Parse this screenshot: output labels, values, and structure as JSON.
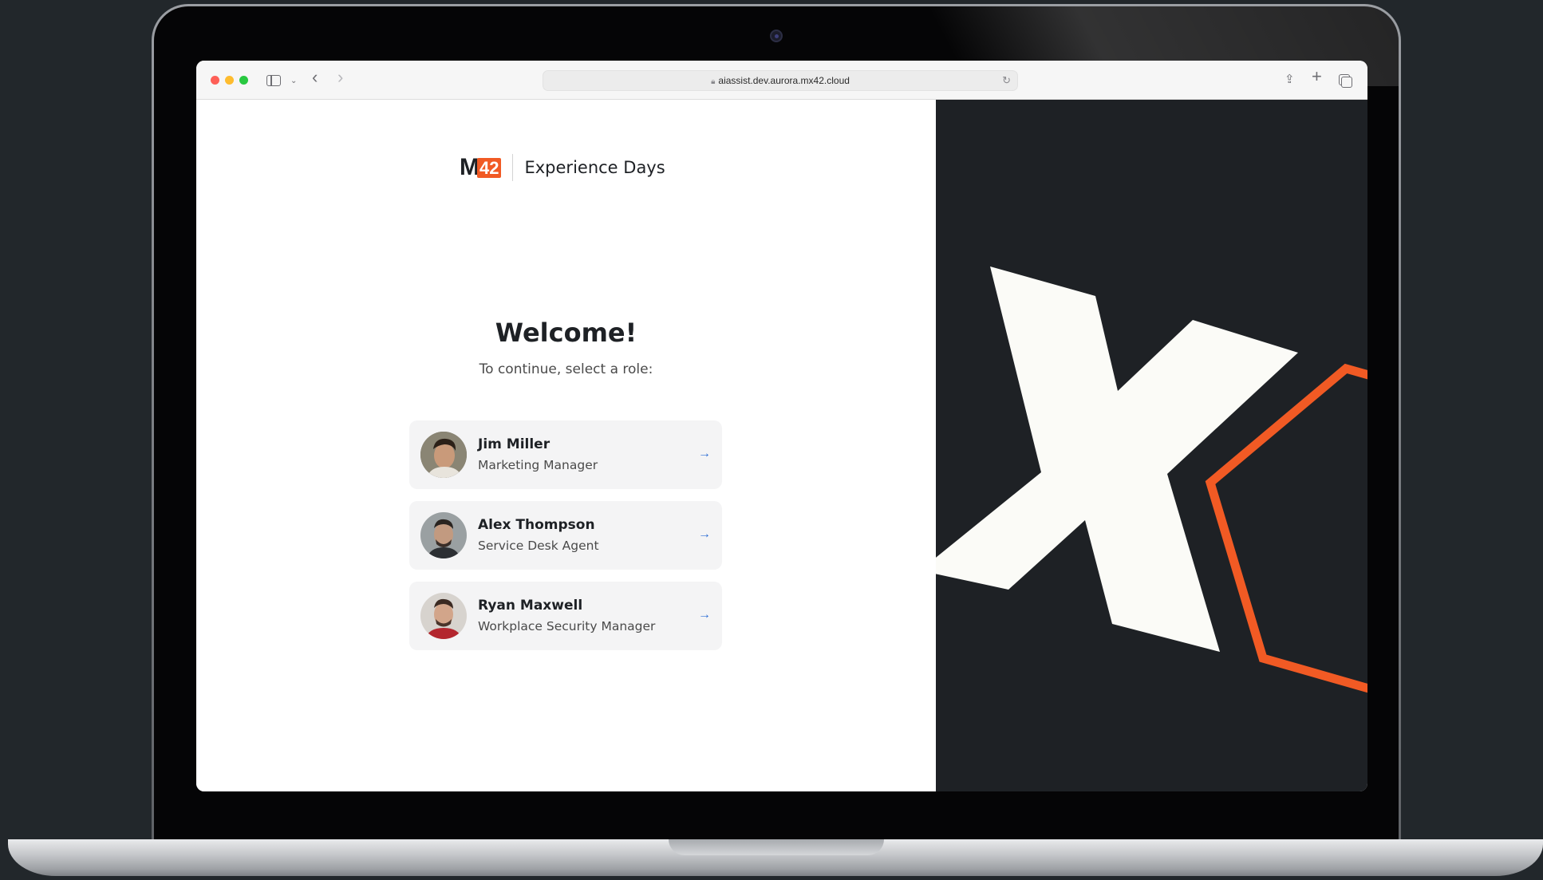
{
  "browser": {
    "url": "aiassist.dev.aurora.mx42.cloud"
  },
  "brand": {
    "logo_m": "M",
    "logo_42": "42",
    "title": "Experience Days"
  },
  "welcome": {
    "heading": "Welcome!",
    "subtitle": "To continue, select a role:"
  },
  "roles": [
    {
      "name": "Jim Miller",
      "title": "Marketing Manager"
    },
    {
      "name": "Alex Thompson",
      "title": "Service Desk Agent"
    },
    {
      "name": "Ryan Maxwell",
      "title": "Workplace Security Manager"
    }
  ],
  "colors": {
    "accent_orange": "#f15a24",
    "dark_panel": "#1e2125",
    "arrow_blue": "#2f6fd6"
  }
}
